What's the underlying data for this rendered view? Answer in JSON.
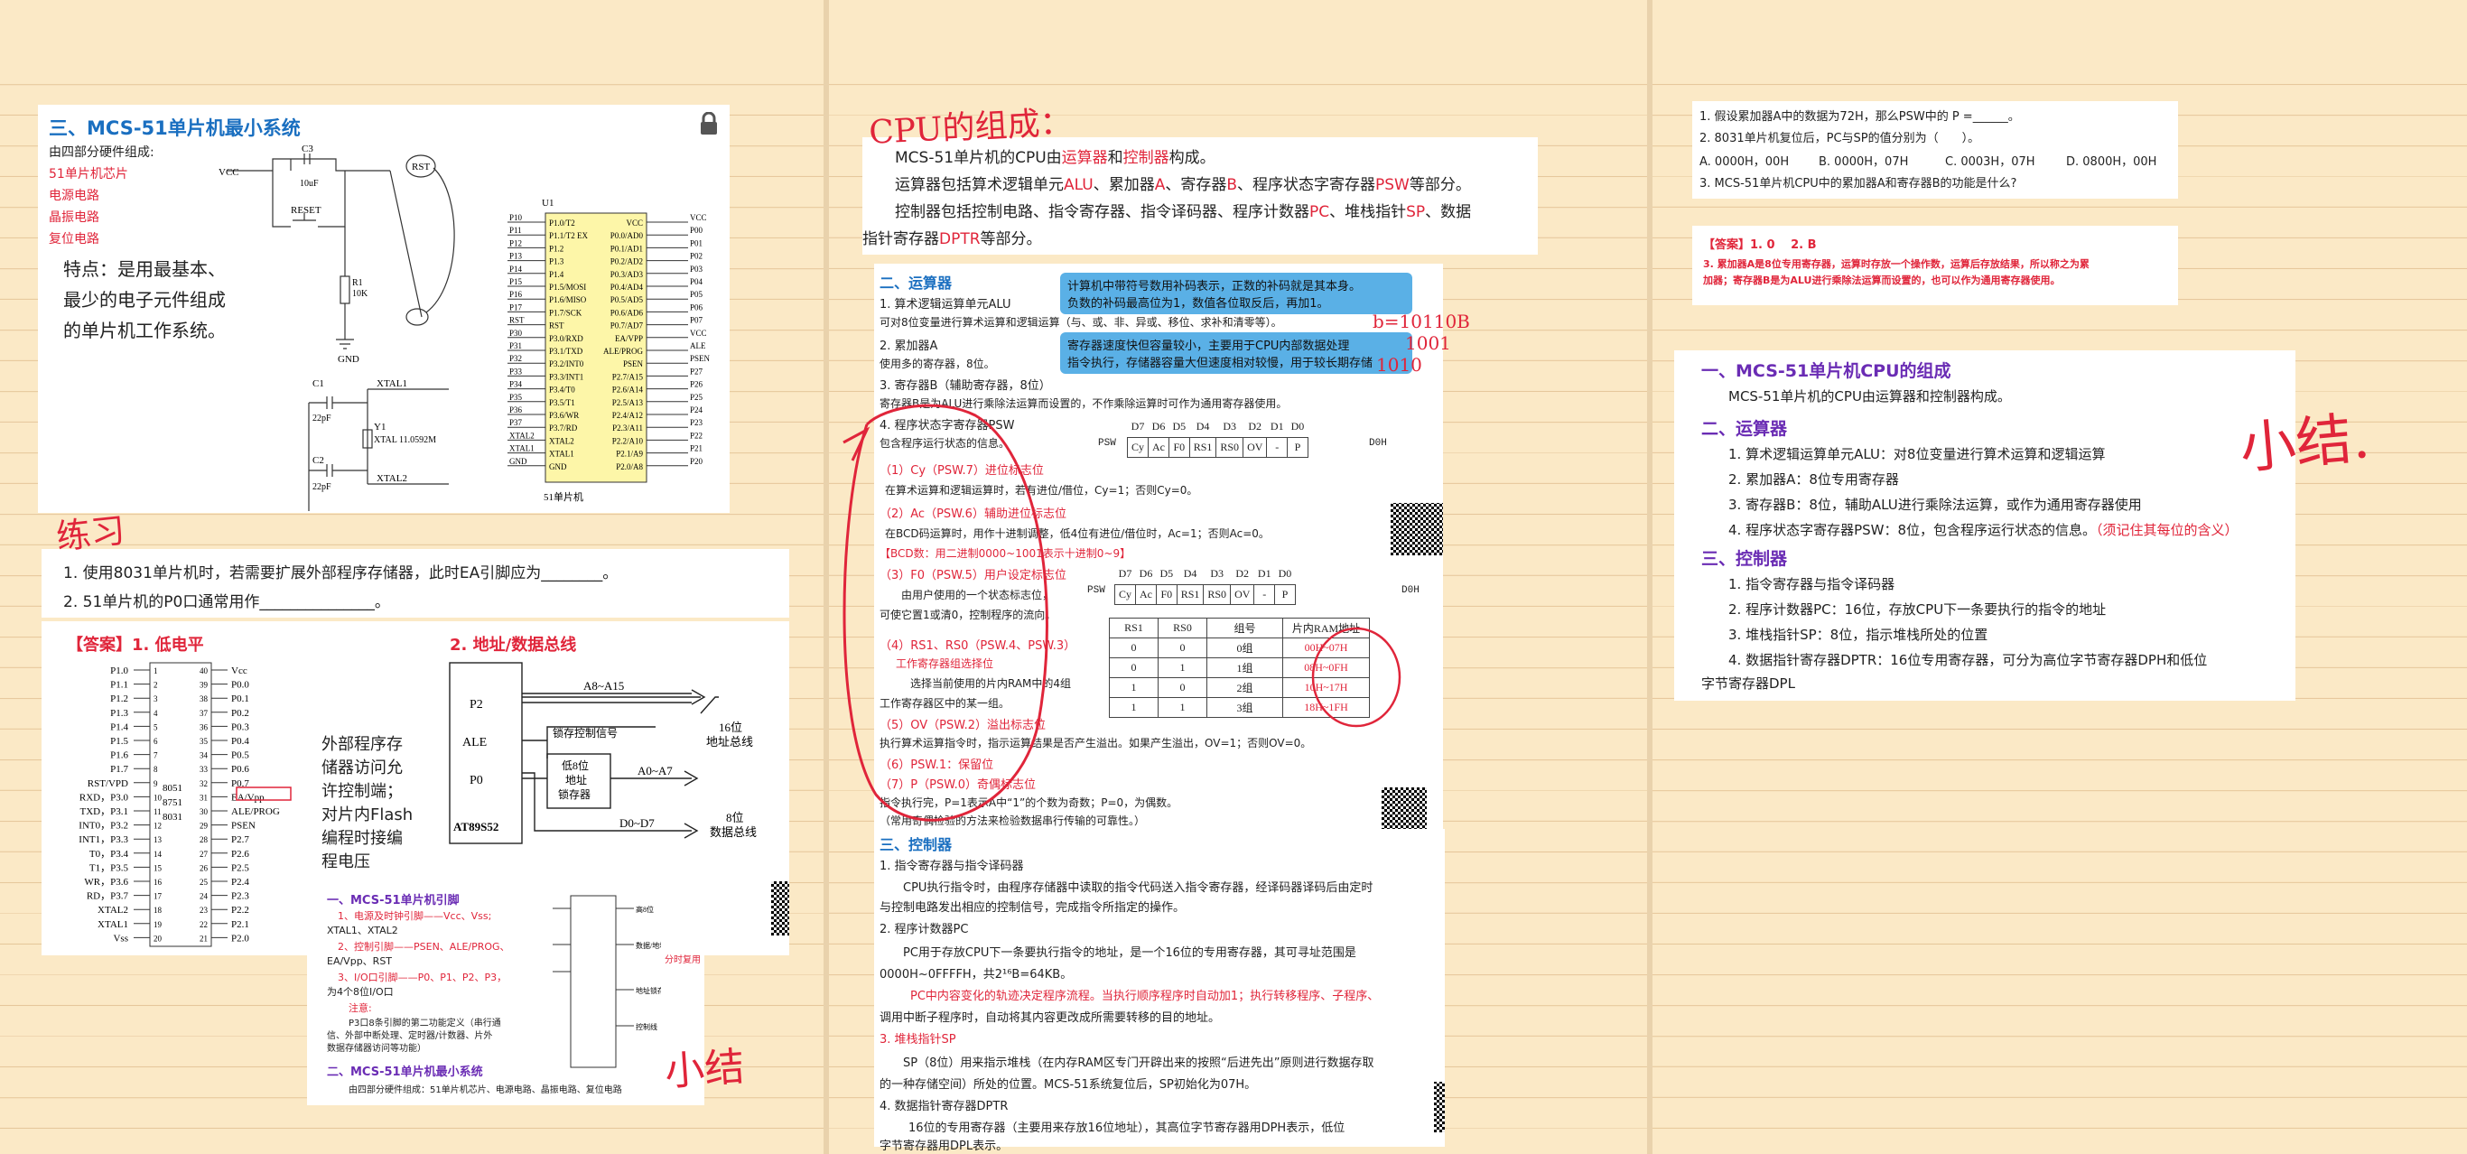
{
  "p1": {
    "min_title": "三、MCS-51单片机最小系统",
    "intro": "由四部分硬件组成:",
    "parts": [
      "51单片机芯片",
      "电源电路",
      "晶振电路",
      "复位电路"
    ],
    "feature": [
      "特点：是用最基本、",
      "最少的电子元件组成",
      "的单片机工作系统。"
    ],
    "schem": {
      "vcc": "VCC",
      "c3": "C3",
      "c3v": "10uF",
      "rst": "RST",
      "reset": "RESET",
      "r1": "R1",
      "r1v": "10K",
      "gnd": "GND",
      "c1": "C1",
      "c1v": "22pF",
      "c2": "C2",
      "c2v": "22pF",
      "xtal1": "XTAL1",
      "xtal2": "XTAL2",
      "y1": "Y1",
      "y1v": "XTAL 11.0592M",
      "u1": "U1",
      "chip": "51单片机"
    },
    "left_pins": [
      "P10",
      "P11",
      "P12",
      "P13",
      "P14",
      "P15",
      "P16",
      "P17",
      "RST",
      "P30",
      "P31",
      "P32",
      "P33",
      "P34",
      "P35",
      "P36",
      "P37",
      "XTAL2",
      "XTAL1",
      "GND"
    ],
    "left_names": [
      "P1.0/T2",
      "P1.1/T2 EX",
      "P1.2",
      "P1.3",
      "P1.4",
      "P1.5/MOSI",
      "P1.6/MISO",
      "P1.7/SCK",
      "RST",
      "P3.0/RXD",
      "P3.1/TXD",
      "P3.2/INT0",
      "P3.3/INT1",
      "P3.4/T0",
      "P3.5/T1",
      "P3.6/WR",
      "P3.7/RD",
      "XTAL2",
      "XTAL1",
      "GND"
    ],
    "right_names": [
      "VCC",
      "P0.0/AD0",
      "P0.1/AD1",
      "P0.2/AD2",
      "P0.3/AD3",
      "P0.4/AD4",
      "P0.5/AD5",
      "P0.6/AD6",
      "P0.7/AD7",
      "EA/VPP",
      "ALE/PROG",
      "PSEN",
      "P2.7/A15",
      "P2.6/A14",
      "P2.5/A13",
      "P2.4/A12",
      "P2.3/A11",
      "P2.2/A10",
      "P2.1/A9",
      "P2.0/A8"
    ],
    "right_pins": [
      "VCC",
      "P00",
      "P01",
      "P02",
      "P03",
      "P04",
      "P05",
      "P06",
      "P07",
      "VCC",
      "ALE",
      "PSEN",
      "P27",
      "P26",
      "P25",
      "P24",
      "P23",
      "P22",
      "P21",
      "P20"
    ],
    "ink_practice": "练习",
    "q1": "1. 使用8031单片机时，若需要扩展外部程序存储器，此时EA引脚应为________。",
    "q2": "2. 51单片机的P0口通常用作_______________。",
    "ans1": "【答案】1. 低电平",
    "ans2": "2. 地址/数据总线",
    "dip_left": [
      "P1.0",
      "P1.1",
      "P1.2",
      "P1.3",
      "P1.4",
      "P1.5",
      "P1.6",
      "P1.7",
      "RST/VPD",
      "RXD，P3.0",
      "TXD，P3.1",
      "INT0，P3.2",
      "INT1，P3.3",
      "T0，P3.4",
      "T1，P3.5",
      "WR，P3.6",
      "RD，P3.7",
      "XTAL2",
      "XTAL1",
      "Vss"
    ],
    "dip_right": [
      "Vcc",
      "P0.0",
      "P0.1",
      "P0.2",
      "P0.3",
      "P0.4",
      "P0.5",
      "P0.6",
      "P0.7",
      "EA/Vpp",
      "ALE/PROG",
      "PSEN",
      "P2.7",
      "P2.6",
      "P2.5",
      "P2.4",
      "P2.3",
      "P2.2",
      "P2.1",
      "P2.0"
    ],
    "dip_mid": [
      "8051",
      "8751",
      "8031"
    ],
    "ea_note": [
      "外部程序存",
      "储器访问允",
      "许控制端；",
      "对片内Flash",
      "编程时接编",
      "程电压"
    ],
    "bus": {
      "p2": "P2",
      "ale": "ALE",
      "p0": "P0",
      "chip": "AT89S52",
      "a815": "A8~A15",
      "latch_sig": "锁存控制信号",
      "latch": [
        "低8位",
        "地址",
        "锁存器"
      ],
      "a07": "A0~A7",
      "d07": "D0~D7",
      "addr": [
        "16位",
        "地址总线"
      ],
      "data": [
        "8位",
        "数据总线"
      ]
    },
    "sum": {
      "t1": "一、MCS-51单片机引脚",
      "l1": "1、电源及时钟引脚——Vcc、Vss;",
      "l1b": "XTAL1、XTAL2",
      "l2": "2、控制引脚——PSEN、ALE/PROG、",
      "l2b": "EA/Vpp、RST",
      "l3": "3、I/O口引脚——P0、P1、P2、P3，",
      "l3b": "为4个8位I/O口",
      "note": "注意:",
      "n1": "P3口8条引脚的第二功能定义（串行通",
      "n2": "信、外部中断处理、定时器/计数器、片外",
      "n3": "数据存储器访问等功能）",
      "t2": "二、MCS-51单片机最小系统",
      "t2l": "由四部分硬件组成：51单片机芯片、电源电路、晶振电路、复位电路",
      "side": [
        "高8位",
        "数据/地址",
        "地址锁存",
        "控制线"
      ],
      "split": "分时复用"
    },
    "ink_summary": "小结"
  },
  "p2": {
    "ink_title": "CPU的组成：",
    "l1a": "MCS-51单片机的CPU由",
    "l1b": "运算器",
    "l1c": "和",
    "l1d": "控制器",
    "l1e": "构成。",
    "l2a": "运算器包括算术逻辑单元",
    "l2b": "ALU",
    "l2c": "、累加器",
    "l2d": "A",
    "l2e": "、寄存器",
    "l2f": "B",
    "l2g": "、程序状态字寄存器",
    "l2h": "PSW",
    "l2i": "等部分。",
    "l3a": "控制器包括控制电路、指令寄存器、指令译码器、程序计数器",
    "l3b": "PC",
    "l3c": "、堆栈指针",
    "l3d": "SP",
    "l3e": "、数据",
    "l4a": "指针寄存器",
    "l4b": "DPTR",
    "l4c": "等部分。",
    "s2": "二、运算器",
    "alu1": "1. 算术逻辑运算单元ALU",
    "alu2": "可对8位变量进行算术运算和逻辑运算（与、或、非、异或、移位、求补和清零等）。",
    "acc1": "2. 累加器A",
    "acc2": "使用多的寄存器，8位。",
    "b1": "3. 寄存器B（辅助寄存器，8位）",
    "b2": "寄存器B是为ALU进行乘除法运算而设置的，不作乘除运算时可作为通用寄存器使用。",
    "psw1": "4. 程序状态字寄存器PSW",
    "psw2": "包含程序运行状态的信息。",
    "note1": [
      "计算机中带符号数用补码表示，正数的补码就是其本身。",
      "负数的补码最高位为1，数值各位取反后，再加1。"
    ],
    "note2": [
      "寄存器速度快但容量较小，主要用于CPU内部数据处理",
      "指令执行，存储器容量大但速度相对较慢，用于较长期存储"
    ],
    "bits": [
      "D7",
      "D6",
      "D5",
      "D4",
      "D3",
      "D2",
      "D1",
      "D0"
    ],
    "psw_cells": [
      "Cy",
      "Ac",
      "F0",
      "RS1",
      "RS0",
      "OV",
      "-",
      "P"
    ],
    "psw_label": "PSW",
    "psw_addr": "D0H",
    "cy1": "（1）Cy（PSW.7）进位标志位",
    "cy2": "在算术运算和逻辑运算时，若有进位/借位，Cy=1；否则Cy=0。",
    "ac1": "（2）Ac（PSW.6）辅助进位标志位",
    "ac2": "在BCD码运算时，用作十进制调整，低4位有进位/借位时，Ac=1；否则Ac=0。",
    "bcd": "【BCD数：用二进制0000~1001表示十进制0~9】",
    "f01": "（3）F0（PSW.5）用户设定标志位",
    "f02": "由用户使用的一个状态标志位，",
    "f03": "可使它置1或清0，控制程序的流向。",
    "rs1": "（4）RS1、RS0（PSW.4、PSW.3）",
    "rs2": "工作寄存器组选择位",
    "rs3": "选择当前使用的片内RAM中的4组",
    "rs4": "工作寄存器区中的某一组。",
    "rs_head": [
      "RS1",
      "RS0",
      "组号",
      "片内RAM地址"
    ],
    "rs_rows": [
      [
        "0",
        "0",
        "0组",
        "00H~07H"
      ],
      [
        "0",
        "1",
        "1组",
        "08H~0FH"
      ],
      [
        "1",
        "0",
        "2组",
        "10H~17H"
      ],
      [
        "1",
        "1",
        "3组",
        "18H~1FH"
      ]
    ],
    "ov1": "（5）OV（PSW.2）溢出标志位",
    "ov2": "执行算术运算指令时，指示运算结果是否产生溢出。如果产生溢出，OV=1；否则OV=0。",
    "p16": "（6）PSW.1：保留位",
    "p17": "（7）P（PSW.0）奇偶标志位",
    "p18": "指令执行完，P=1表示A中“1”的个数为奇数；P=0，为偶数。",
    "p19": "（常用奇偶检验的方法来检验数据串行传输的可靠性。）",
    "ink_b": "b=10110B",
    "ink_1001": "1001",
    "ink_1010": "1010",
    "s3": "三、控制器",
    "c1": "1. 指令寄存器与指令译码器",
    "c1a": "CPU执行指令时，由程序存储器中读取的指令代码送入指令寄存器，经译码器译码后由定时",
    "c1b": "与控制电路发出相应的控制信号，完成指令所指定的操作。",
    "c2": "2. 程序计数器PC",
    "c2a": "PC用于存放CPU下一条要执行指令的地址，是一个16位的专用寄存器，其可寻址范围是",
    "c2b": "0000H~0FFFFH，共2¹⁶B=64KB。",
    "c2c": "PC中内容变化的轨迹决定程序流程。当执行顺序程序时自动加1；执行转移程序、子程序、",
    "c2d": "调用中断子程序时，自动将其内容更改成所需要转移的目的地址。",
    "c3": "3. 堆栈指针SP",
    "c3a": "SP（8位）用来指示堆栈（在内存RAM区专门开辟出来的按照“后进先出”原则进行数据存取",
    "c3b": "的一种存储空间）所处的位置。MCS-51系统复位后，SP初始化为07H。",
    "c4": "4. 数据指针寄存器DPTR",
    "c4a": "16位的专用寄存器（主要用来存放16位地址），其高位字节寄存器用DPH表示，低位",
    "c4b": "字节寄存器用DPL表示。"
  },
  "p3": {
    "q1": "1. 假设累加器A中的数据为72H，那么PSW中的 P =______。",
    "q2": "2. 8031单片机复位后，PC与SP的值分别为（　　）。",
    "opts": [
      "A. 0000H，00H",
      "B. 0000H，07H",
      "C. 0003H，07H",
      "D. 0800H，00H"
    ],
    "q3": "3. MCS-51单片机CPU中的累加器A和寄存器B的功能是什么?",
    "ans1": "【答案】1. 0　 2. B",
    "ans2": "3. 累加器A是8位专用寄存器，运算时存放一个操作数，运算后存放结果，所以称之为累",
    "ans3": "加器；寄存器B是为ALU进行乘除法运算而设置的，也可以作为通用寄存器使用。",
    "h1": "一、MCS-51单片机CPU的组成",
    "h1a": "MCS-51单片机的CPU由运算器和控制器构成。",
    "h2": "二、运算器",
    "h2a": "1. 算术逻辑运算单元ALU：对8位变量进行算术运算和逻辑运算",
    "h2b": "2. 累加器A：8位专用寄存器",
    "h2c": "3. 寄存器B：8位，辅助ALU进行乘除法运算，或作为通用寄存器使用",
    "h2d": "4. 程序状态字寄存器PSW：8位，包含程序运行状态的信息。",
    "h2d_red": "（须记住其每位的含义）",
    "h3": "三、控制器",
    "h3a": "1. 指令寄存器与指令译码器",
    "h3b": "2. 程序计数器PC：16位，存放CPU下一条要执行的指令的地址",
    "h3c": "3. 堆栈指针SP：8位，指示堆栈所处的位置",
    "h3d": "4. 数据指针寄存器DPTR：16位专用寄存器，可分为高位字节寄存器DPH和低位",
    "h3e": "字节寄存器DPL",
    "ink_summary": "小结."
  },
  "colors": {
    "accent_red": "#e0253a",
    "heading_blue": "#1a6fc0",
    "purple": "#6a2cb4",
    "paper": "#fbe9c6",
    "note_blue": "#5ab0e6"
  }
}
